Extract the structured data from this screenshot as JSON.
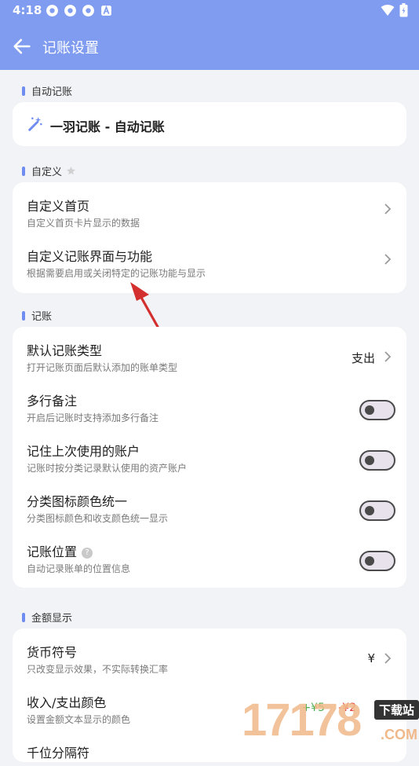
{
  "status_bar": {
    "time": "4:18"
  },
  "app_bar": {
    "title": "记账设置"
  },
  "sections": {
    "auto": {
      "header": "自动记账",
      "item_label": "一羽记账 - 自动记账"
    },
    "custom": {
      "header": "自定义",
      "items": [
        {
          "title": "自定义首页",
          "subtitle": "自定义首页卡片显示的数据"
        },
        {
          "title": "自定义记账界面与功能",
          "subtitle": "根据需要启用或关闭特定的记账功能与显示"
        }
      ]
    },
    "bookkeeping": {
      "header": "记账",
      "items": [
        {
          "title": "默认记账类型",
          "subtitle": "打开记账页面后默认添加的账单类型",
          "value": "支出"
        },
        {
          "title": "多行备注",
          "subtitle": "开启后记账时支持添加多行备注",
          "enabled": false
        },
        {
          "title": "记住上次使用的账户",
          "subtitle": "记账时按分类记录默认使用的资产账户",
          "enabled": false
        },
        {
          "title": "分类图标颜色统一",
          "subtitle": "分类图标颜色和收支颜色统一显示",
          "enabled": false
        },
        {
          "title": "记账位置",
          "subtitle": "自动记录账单的位置信息",
          "enabled": false
        }
      ]
    },
    "amount": {
      "header": "金额显示",
      "items": [
        {
          "title": "货币符号",
          "subtitle": "只改变显示效果，不实际转换汇率",
          "value": "¥"
        },
        {
          "title": "收入/支出颜色",
          "subtitle": "设置金额文本显示的颜色",
          "income_sample": "+¥5",
          "expense_sample": "-¥2"
        },
        {
          "title": "千位分隔符"
        }
      ]
    }
  },
  "watermark": {
    "digits": "17178",
    "label": "下载站",
    "domain": ".COM"
  },
  "colors": {
    "accent": "#7f9cf0",
    "background": "#f2f3f7",
    "annotation": "#d32f2f"
  }
}
